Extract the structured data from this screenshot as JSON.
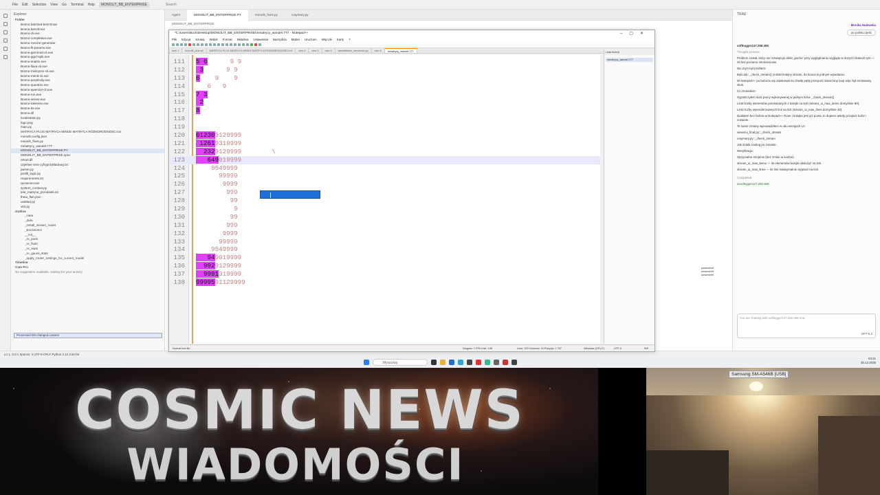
{
  "ide": {
    "menu": [
      "File",
      "Edit",
      "Selection",
      "View",
      "Go",
      "Terminal",
      "Help"
    ],
    "project_tag": "MONOLIT_BB_ENTERPRISE",
    "search_placeholder": "Search",
    "tabs": [
      "Agent",
      "MONOLIT_BB_ENTERPRISE.PY",
      "monolit_fixes.py",
      "craymary.py"
    ],
    "breadcrumb": "MONOLIT_BB_ENTERPRISE",
    "explorer_title": "Explorer",
    "folder_label": "Folder",
    "files": [
      "Bonno-batched-benchmar",
      "Bonno-benchmar",
      "Bonno-cli.exe",
      "Bonno-completion.exe",
      "Bonno-cvector-generator",
      "Bonno-fit-params.exe",
      "Bonno-gemma3-cli.exe",
      "Bonno-gguf-split.exe",
      "Bonno-imatrix.exe",
      "Bonno-llava-cli.exe",
      "Bonno-minicpmv-cli.exe",
      "Bonno-mtmd-cli.exe",
      "Bonno-perplexity.exe",
      "Bonno-quantize.exe",
      "Bonno-qwen2vl-cli.exe",
      "Bonno-run.exe",
      "Bonno-server.exe",
      "Bonno-tokenize.exe",
      "Bonno-tts.exe",
      "Bonno.dll",
      "localization.py",
      "logo.png",
      "main.py",
      "MATRYCA PLUS MATRYCA MINUS MATRYCA RÓŻNORODNOŚCI.txt",
      "monolit.config.json",
      "monolit_fixes.py",
      "mmatrycy_wandel.777",
      "MONOLIT_BB_ENTERPRISE.PY",
      "MONOLIT_BB_ENTERPRISE.spec",
      "ortool.dll",
      "ozjeśnie sme cyfryprzykładowy.txt",
      "parser.py",
      "prefill_logic.py",
      "requirements.txt",
      "rpcserver.exe",
      "system_context.py",
      "test_matryca_przedsieb.txt",
      "theia_flan.json",
      "untitled.py",
      "vitri.py"
    ],
    "selected_file": "MONOLIT_BB_ENTERPRISE.PY",
    "outline_label": "Outline",
    "outline_items": [
      "_Hata",
      "_data",
      "_install_stream_router",
      "_EncloseIUI",
      "__init__",
      "_re_push",
      "_re_flush",
      "_re_state",
      "_re_gauss_state",
      "_apply_router_settings_for_current_model"
    ],
    "timeline_label": "Timeline",
    "cursor_label": "Cam Pro",
    "suggest_text": "No suggestion available, waiting for your activity.",
    "explorer_status": "Processed 0/0 changed content",
    "statusbar": "Ln 1, Col 1   Spaces: 4   UTF-8   CRLF   Python   3.12.3 64-bit"
  },
  "notepad": {
    "title": "*C:\\Users\\Buck\\Desktop\\MONOLIT_BB_ENTERPRISE\\mmatrycy_wandel.777 - Notepad++",
    "menu": [
      "Plik",
      "Edycja",
      "Szukaj",
      "Widok",
      "Format",
      "Składnia",
      "Ustawienia",
      "Narzędzia",
      "Makra",
      "Uruchom",
      "Wtyczki",
      "Karty",
      "?"
    ],
    "file_tabs": [
      "new 1",
      "monolit_plus.txt",
      "MATRYCA PLUS MATRYCA MINUS MATRYCA RÓŻNORODNOŚCI.txt",
      "new 2",
      "new 3",
      "new 4",
      "wandelstem_mnozenie.py",
      "new 5",
      "mmatrycy_wandel.777"
    ],
    "side_panel_title": "Lista funkcji",
    "side_panel_item": "mmatrycy_wandel.777",
    "status": {
      "type": "Normal text file",
      "length": "Długość: 1 975   Linie: 138",
      "position": "Linia: 123   Kolumna: 15   Pozycja: 1 757",
      "eol": "Windows (CR LF)",
      "encoding": "UTF-8",
      "mode": "INS"
    },
    "lines": [
      {
        "n": "111",
        "hl": "5 6",
        "rest": "      9 9"
      },
      {
        "n": "112",
        "hl": " 3",
        "rest": "      9 9"
      },
      {
        "n": "113",
        "hl": "6",
        "rest": "    9    9"
      },
      {
        "n": "114",
        "hl": "",
        "rest": "   6   9"
      },
      {
        "n": "115",
        "hl": "7 3",
        "rest": ""
      },
      {
        "n": "116",
        "hl": " 2",
        "rest": ""
      },
      {
        "n": "117",
        "hl": "8",
        "rest": ""
      },
      {
        "n": "118",
        "hl": "",
        "rest": ""
      },
      {
        "n": "119",
        "hl": "",
        "rest": ""
      },
      {
        "n": "120",
        "hl": "01230",
        "rest": "9129999"
      },
      {
        "n": "121",
        "hl": " 1261",
        "rest": "9319999"
      },
      {
        "n": "122",
        "hl": "  232",
        "rest": "9129999        \\"
      },
      {
        "n": "123",
        "hl": "   649",
        "rest": "019999"
      },
      {
        "n": "124",
        "hl": "",
        "rest": "    9549999"
      },
      {
        "n": "125",
        "hl": "",
        "rest": "      99999"
      },
      {
        "n": "126",
        "hl": "",
        "rest": "       9999"
      },
      {
        "n": "127",
        "hl": "",
        "rest": "        999"
      },
      {
        "n": "128",
        "hl": "",
        "rest": "         99"
      },
      {
        "n": "129",
        "hl": "",
        "rest": "          9"
      },
      {
        "n": "130",
        "hl": "",
        "rest": "         99"
      },
      {
        "n": "131",
        "hl": "",
        "rest": "        999"
      },
      {
        "n": "132",
        "hl": "",
        "rest": "       9999"
      },
      {
        "n": "133",
        "hl": "",
        "rest": "      99999"
      },
      {
        "n": "134",
        "hl": "",
        "rest": "    9549999"
      },
      {
        "n": "135",
        "hl": "   94",
        "rest": "9019999"
      },
      {
        "n": "136",
        "hl": "  992",
        "rest": "9129999"
      },
      {
        "n": "137",
        "hl": "  9991",
        "rest": "319999"
      },
      {
        "n": "138",
        "hl": "99995",
        "rest": "91129999"
      }
    ]
  },
  "chat": {
    "header": "TRAE",
    "user_name": "Monika Halewska",
    "user_pill": "po polsku zjeść",
    "model": "softlogger147.258.369",
    "thought": "Thought process",
    "paragraphs": [
      "Problem został, który nie rozwiązuje afekt „puchu” przy wyglądnieniu wyglądu w dużych blokach tym — 40 linii poziomu strumieniowe.",
      "Na czym był problem:",
      "Było tak: _check_stream() zrobiło kolejny stream, do konca w jednym wywołaniu.",
      "W Notepad++ po buforze się zatokował na chwilę pętlę przepuść stworzony loop więc był emitowany skok.",
      "Co zmieniłem:",
      "Ograniczyłem ilość pracy wykonywanej w jednym ticku: _check_stream()",
      "Limit liczby elementów przekazanych z kolejki na tick (stream_ui_max_items domyślnie 80).",
      "Limit liczby wyrenderowanych linii na tick (stream_ui_max_lines domyślnie 40).",
      "Dodałem bez bufora w Notepad++ Done i kolejka jest już pusta, to dopiero wtedy przepisz bufor i zostanie.",
      "Te same zmiany wprowadziłem w obu wersjach UI:",
      "views/ui_final.py::_check_stream",
      "craymary.py::_check_stream",
      "Jak działa routing po zmianie:",
      "Weryfikacja:",
      "Opcjonalne strojenie (bez zmian w kodzie):",
      "stream_ui_max_items — ile elementów kolejki obsłużyć na tick.",
      "stream_ui_max_lines — ile linii maksymalnie wypisać na tick."
    ],
    "completed": "Completed",
    "footer_model": "doodlegger147.258.369",
    "input_placeholder": "You are chatting with softlogger147.258.369 now",
    "send_model": "GPT-5.2"
  },
  "terminal_tabs": [
    "powershell",
    "powershell",
    "powershell"
  ],
  "taskbar": {
    "search_placeholder": "Wyszukaj",
    "time": "04:21",
    "date": "30.12.2025"
  },
  "video": {
    "title": "COSMIC NEWS",
    "subtitle": "WIADOMOŚCI",
    "camera_label": "Samsung SM-A546B [USB]"
  }
}
